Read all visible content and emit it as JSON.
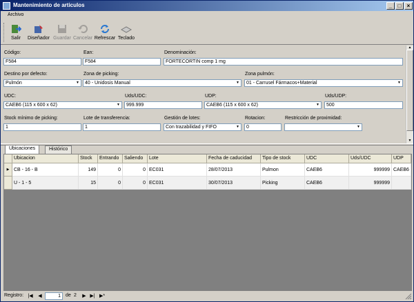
{
  "window": {
    "title": "Mantenimiento de articulos",
    "min": "_",
    "max": "□",
    "close": "×"
  },
  "menu": {
    "archivo": "Archivo"
  },
  "toolbar": {
    "salir": "Salir",
    "disenador": "Diseñador",
    "guardar": "Guardar",
    "cancelar": "Cancelar",
    "refrescar": "Refrescar",
    "teclado": "Teclado",
    "icons": {
      "salir": "exit-icon",
      "disenador": "designer-icon",
      "guardar": "save-icon",
      "cancelar": "undo-icon",
      "refrescar": "refresh-icon",
      "teclado": "keyboard-icon"
    }
  },
  "form": {
    "codigo_label": "Código:",
    "codigo": "F584",
    "ean_label": "Ean:",
    "ean": "F584",
    "denominacion_label": "Denominación:",
    "denominacion": "FORTECORTIN comp 1 mg",
    "destino_label": "Destino por defecto:",
    "destino": "Pulmón",
    "zona_picking_label": "Zona de picking:",
    "zona_picking": "40 - Unidosis Manual",
    "zona_pulmon_label": "Zona pulmón:",
    "zona_pulmon": "01 - Carrusel Fármacos+Material",
    "udc_label": "UDC:",
    "udc": "CAEB6 (115 x 600 x 62)",
    "uds_udc_label": "Uds/UDC:",
    "uds_udc": "999.999",
    "udp_label": "UDP:",
    "udp": "CAEB6 (115 x 600 x 62)",
    "uds_udp_label": "Uds/UDP:",
    "uds_udp": "500",
    "stock_min_label": "Stock mínimo de picking:",
    "stock_min": "1",
    "lote_trans_label": "Lote de transferencia:",
    "lote_trans": "1",
    "gestion_lotes_label": "Gestión de lotes:",
    "gestion_lotes": "Con trazabilidad y FIFO",
    "rotacion_label": "Rotacion:",
    "rotacion": "0",
    "restriccion_label": "Restricción de proximidad:",
    "restriccion": ""
  },
  "tabs": {
    "ubicaciones": "Ubicaciones",
    "historico": "Histórico"
  },
  "grid": {
    "headers": [
      "Ubicacion",
      "Stock",
      "Entrando",
      "Saliendo",
      "Lote",
      "Fecha de caducidad",
      "Tipo de stock",
      "UDC",
      "Uds/UDC",
      "UDP"
    ],
    "rows": [
      [
        "CB - 16 - B",
        "149",
        "0",
        "0",
        "EC031",
        "28/07/2013",
        "Pulmon",
        "CAEB6",
        "999999",
        "CAEB6"
      ],
      [
        "U - 1 - 5",
        "15",
        "0",
        "0",
        "EC031",
        "30/07/2013",
        "Picking",
        "CAEB6",
        "999999",
        ""
      ]
    ]
  },
  "status": {
    "registro_label": "Registro:",
    "page": "1",
    "de_label": "de",
    "total": "2"
  }
}
